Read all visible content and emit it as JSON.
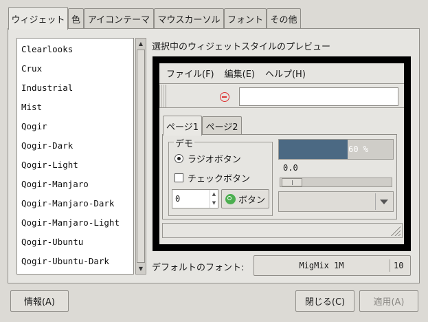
{
  "tabs": [
    {
      "label": "ウィジェット",
      "active": true
    },
    {
      "label": "色"
    },
    {
      "label": "アイコンテーマ"
    },
    {
      "label": "マウスカーソル"
    },
    {
      "label": "フォント"
    },
    {
      "label": "その他"
    }
  ],
  "theme_list": [
    "Clearlooks",
    "Crux",
    "Industrial",
    "Mist",
    "Qogir",
    "Qogir-Dark",
    "Qogir-Light",
    "Qogir-Manjaro",
    "Qogir-Manjaro-Dark",
    "Qogir-Manjaro-Light",
    "Qogir-Ubuntu",
    "Qogir-Ubuntu-Dark"
  ],
  "preview": {
    "label": "選択中のウィジェットスタイルのプレビュー",
    "menu": [
      "ファイル(F)",
      "編集(E)",
      "ヘルプ(H)"
    ],
    "tabs": [
      "ページ1",
      "ページ2"
    ],
    "demo_frame_label": "デモ",
    "radio_label": "ラジオボタン",
    "check_label": "チェックボタン",
    "spin_value": "0",
    "button_label": "ボタン",
    "progress_text": "60 %",
    "progress_fraction": 0.6,
    "scale_value": "0.0"
  },
  "font": {
    "label": "デフォルトのフォント:",
    "name": "MigMix 1M",
    "size": "10"
  },
  "buttons": {
    "info": "情報(A)",
    "close": "閉じる(C)",
    "apply": "適用(A)"
  },
  "colors": {
    "accent": "#4b6983",
    "window_bg": "#dcdad5",
    "error_icon": "#dd3333"
  }
}
